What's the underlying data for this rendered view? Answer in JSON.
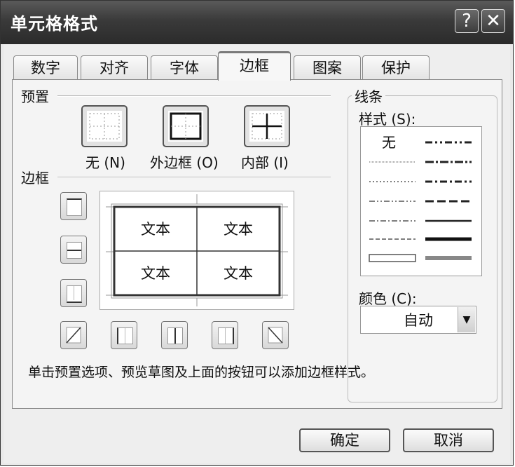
{
  "window": {
    "title": "单元格格式",
    "help_label": "?",
    "close_label": "✕"
  },
  "tabs": [
    {
      "label": "数字"
    },
    {
      "label": "对齐"
    },
    {
      "label": "字体"
    },
    {
      "label": "边框",
      "active": true
    },
    {
      "label": "图案"
    },
    {
      "label": "保护"
    }
  ],
  "presets": {
    "section_label": "预置",
    "none_label": "无 (N)",
    "outline_label": "外边框 (O)",
    "inside_label": "内部 (I)"
  },
  "border": {
    "section_label": "边框",
    "preview_cells": [
      "文本",
      "文本",
      "文本",
      "文本"
    ]
  },
  "line": {
    "group_label": "线条",
    "style_label": "样式 (S):",
    "none_style_label": "无",
    "color_label": "颜色 (C):",
    "color_value": "自动"
  },
  "hint": "单击预置选项、预览草图及上面的按钮可以添加边框样式。",
  "buttons": {
    "ok": "确定",
    "cancel": "取消"
  }
}
